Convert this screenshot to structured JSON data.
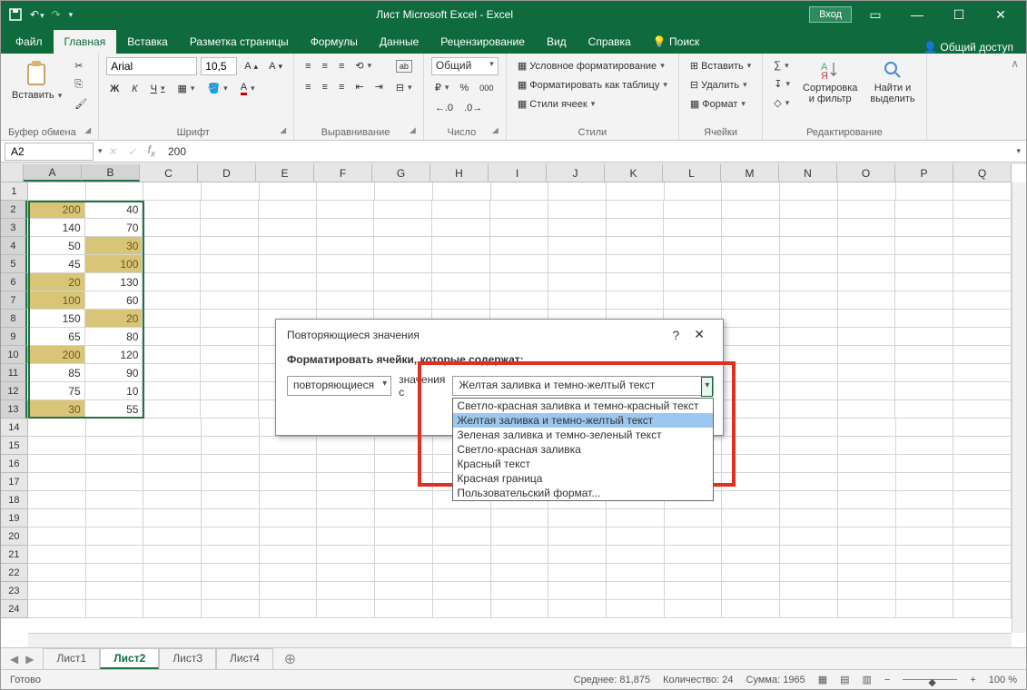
{
  "titlebar": {
    "title": "Лист Microsoft Excel  -  Excel",
    "login": "Вход"
  },
  "tabs": {
    "file": "Файл",
    "home": "Главная",
    "insert": "Вставка",
    "layout": "Разметка страницы",
    "formulas": "Формулы",
    "data": "Данные",
    "review": "Рецензирование",
    "view": "Вид",
    "help": "Справка",
    "search": "Поиск",
    "share": "Общий доступ"
  },
  "ribbon": {
    "clipboard": {
      "paste": "Вставить",
      "group": "Буфер обмена"
    },
    "font": {
      "name": "Arial",
      "size": "10,5",
      "bold": "Ж",
      "italic": "К",
      "underline": "Ч",
      "group": "Шрифт"
    },
    "alignment": {
      "wrap": "",
      "merge": "",
      "group": "Выравнивание"
    },
    "number": {
      "format": "Общий",
      "group": "Число"
    },
    "styles": {
      "cond": "Условное форматирование",
      "table": "Форматировать как таблицу",
      "cell": "Стили ячеек",
      "group": "Стили"
    },
    "cells": {
      "insert": "Вставить",
      "delete": "Удалить",
      "format": "Формат",
      "group": "Ячейки"
    },
    "editing": {
      "sort": "Сортировка\nи фильтр",
      "find": "Найти и\nвыделить",
      "group": "Редактирование"
    }
  },
  "formula_bar": {
    "name_box": "A2",
    "formula": "200"
  },
  "columns": [
    "A",
    "B",
    "C",
    "D",
    "E",
    "F",
    "G",
    "H",
    "I",
    "J",
    "K",
    "L",
    "M",
    "N",
    "O",
    "P",
    "Q"
  ],
  "chart_data": {
    "type": "table",
    "rows": [
      {
        "n": 1,
        "A": "",
        "B": ""
      },
      {
        "n": 2,
        "A": "200",
        "B": "40",
        "hlA": true
      },
      {
        "n": 3,
        "A": "140",
        "B": "70"
      },
      {
        "n": 4,
        "A": "50",
        "B": "30",
        "hlB": true
      },
      {
        "n": 5,
        "A": "45",
        "B": "100",
        "hlB": true
      },
      {
        "n": 6,
        "A": "20",
        "B": "130",
        "hlA": true
      },
      {
        "n": 7,
        "A": "100",
        "B": "60",
        "hlA": true
      },
      {
        "n": 8,
        "A": "150",
        "B": "20",
        "hlB": true
      },
      {
        "n": 9,
        "A": "65",
        "B": "80"
      },
      {
        "n": 10,
        "A": "200",
        "B": "120",
        "hlA": true
      },
      {
        "n": 11,
        "A": "85",
        "B": "90"
      },
      {
        "n": 12,
        "A": "75",
        "B": "10"
      },
      {
        "n": 13,
        "A": "30",
        "B": "55",
        "hlA": true
      }
    ],
    "empty_rows": [
      14,
      15,
      16,
      17,
      18,
      19,
      20,
      21,
      22,
      23,
      24
    ]
  },
  "sheet_tabs": [
    "Лист1",
    "Лист2",
    "Лист3",
    "Лист4"
  ],
  "active_sheet": 1,
  "status": {
    "ready": "Готово",
    "avg_label": "Среднее:",
    "avg": "81,875",
    "count_label": "Количество:",
    "count": "24",
    "sum_label": "Сумма:",
    "sum": "1965",
    "zoom": "100 %"
  },
  "dialog": {
    "title": "Повторяющиеся значения",
    "subtitle": "Форматировать ячейки, которые содержат:",
    "type_value": "повторяющиеся",
    "middle_label": "значения с",
    "format_value": "Желтая заливка и темно-желтый текст",
    "options": [
      "Светло-красная заливка и темно-красный текст",
      "Желтая заливка и темно-желтый текст",
      "Зеленая заливка и темно-зеленый текст",
      "Светло-красная заливка",
      "Красный текст",
      "Красная граница",
      "Пользовательский формат..."
    ],
    "selected_option": 1
  }
}
